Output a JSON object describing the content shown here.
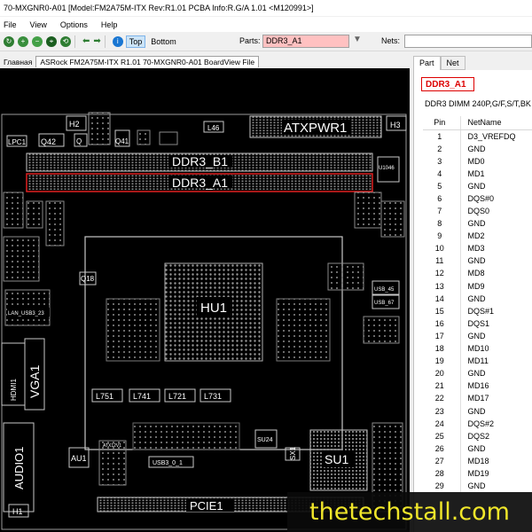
{
  "window": {
    "title": "70-MXGNR0-A01 [Model:FM2A75M-ITX Rev:R1.01 PCBA Info:R.G/A 1.01   <M120991>]"
  },
  "menu": [
    "File",
    "View",
    "Options",
    "Help"
  ],
  "toolbar": {
    "top_label": "Top",
    "bottom_label": "Bottom",
    "parts_label": "Parts:",
    "parts_value": "DDR3_A1",
    "nets_label": "Nets:",
    "nets_value": ""
  },
  "tabs": {
    "main_label": "Главная",
    "file_label": "ASRock FM2A75M-ITX R1.01 70-MXGNR0-A01 BoardView File"
  },
  "board": {
    "labels": {
      "h2": "H2",
      "lpc1": "LPC1",
      "q42": "Q42",
      "q_left": "Q",
      "q41": "Q41",
      "l46": "L46",
      "atxpwr1": "ATXPWR1",
      "h3": "H3",
      "ddr3_b1": "DDR3_B1",
      "ddr3_a1": "DDR3_A1",
      "u1046": "U1046",
      "q18": "Q18",
      "hu1": "HU1",
      "usb_45": "USB_45",
      "usb_67": "USB_67",
      "lan_usb3_23": "LAN_USB3_23",
      "hdmi1": "HDMI1",
      "vga1": "VGA1",
      "l751": "L751",
      "l741": "L741",
      "l721": "L721",
      "l731": "L731",
      "audio1": "AUDIO1",
      "au1": "AU1",
      "atx12v1": "ATX12V1",
      "su24": "SU24",
      "usb3_0_1": "USB3_0_1",
      "sx1": "SX1",
      "su1": "SU1",
      "pcie1": "PCIE1",
      "h1": "H1"
    }
  },
  "right_panel": {
    "tab_part": "Part",
    "tab_net": "Net",
    "part_name": "DDR3_A1",
    "part_desc": "DDR3 DIMM 240P,G/F,S/T,BK",
    "col_pin": "Pin",
    "col_netname": "NetName",
    "rows": [
      {
        "pin": "1",
        "net": "D3_VREFDQ"
      },
      {
        "pin": "2",
        "net": "GND"
      },
      {
        "pin": "3",
        "net": "MD0"
      },
      {
        "pin": "4",
        "net": "MD1"
      },
      {
        "pin": "5",
        "net": "GND"
      },
      {
        "pin": "6",
        "net": "DQS#0"
      },
      {
        "pin": "7",
        "net": "DQS0"
      },
      {
        "pin": "8",
        "net": "GND"
      },
      {
        "pin": "9",
        "net": "MD2"
      },
      {
        "pin": "10",
        "net": "MD3"
      },
      {
        "pin": "11",
        "net": "GND"
      },
      {
        "pin": "12",
        "net": "MD8"
      },
      {
        "pin": "13",
        "net": "MD9"
      },
      {
        "pin": "14",
        "net": "GND"
      },
      {
        "pin": "15",
        "net": "DQS#1"
      },
      {
        "pin": "16",
        "net": "DQS1"
      },
      {
        "pin": "17",
        "net": "GND"
      },
      {
        "pin": "18",
        "net": "MD10"
      },
      {
        "pin": "19",
        "net": "MD11"
      },
      {
        "pin": "20",
        "net": "GND"
      },
      {
        "pin": "21",
        "net": "MD16"
      },
      {
        "pin": "22",
        "net": "MD17"
      },
      {
        "pin": "23",
        "net": "GND"
      },
      {
        "pin": "24",
        "net": "DQS#2"
      },
      {
        "pin": "25",
        "net": "DQS2"
      },
      {
        "pin": "26",
        "net": "GND"
      },
      {
        "pin": "27",
        "net": "MD18"
      },
      {
        "pin": "28",
        "net": "MD19"
      },
      {
        "pin": "29",
        "net": "GND"
      }
    ]
  },
  "watermark": "thetechstall.com",
  "colors": {
    "board_bg": "#000000",
    "outline": "#c8c8c8",
    "highlight": "#e02020",
    "parts_input_bg": "#ffc1c1",
    "watermark_text": "#f0e62a"
  }
}
